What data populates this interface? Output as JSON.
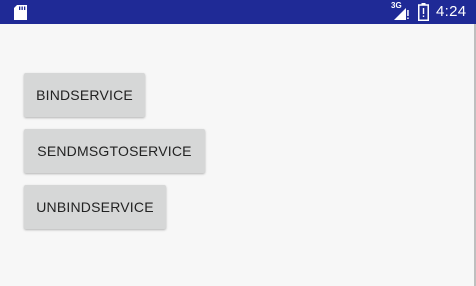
{
  "status_bar": {
    "network": "3G",
    "time": "4:24",
    "background_color": "#1f2a96",
    "icons": [
      "sd-card-icon",
      "signal-icon",
      "battery-icon"
    ]
  },
  "buttons": [
    {
      "label": "BINDSERVICE"
    },
    {
      "label": "SENDMSGTOSERVICE"
    },
    {
      "label": "UNBINDSERVICE"
    }
  ],
  "colors": {
    "button_background": "#d6d7d7",
    "content_background": "#f7f7f7"
  }
}
